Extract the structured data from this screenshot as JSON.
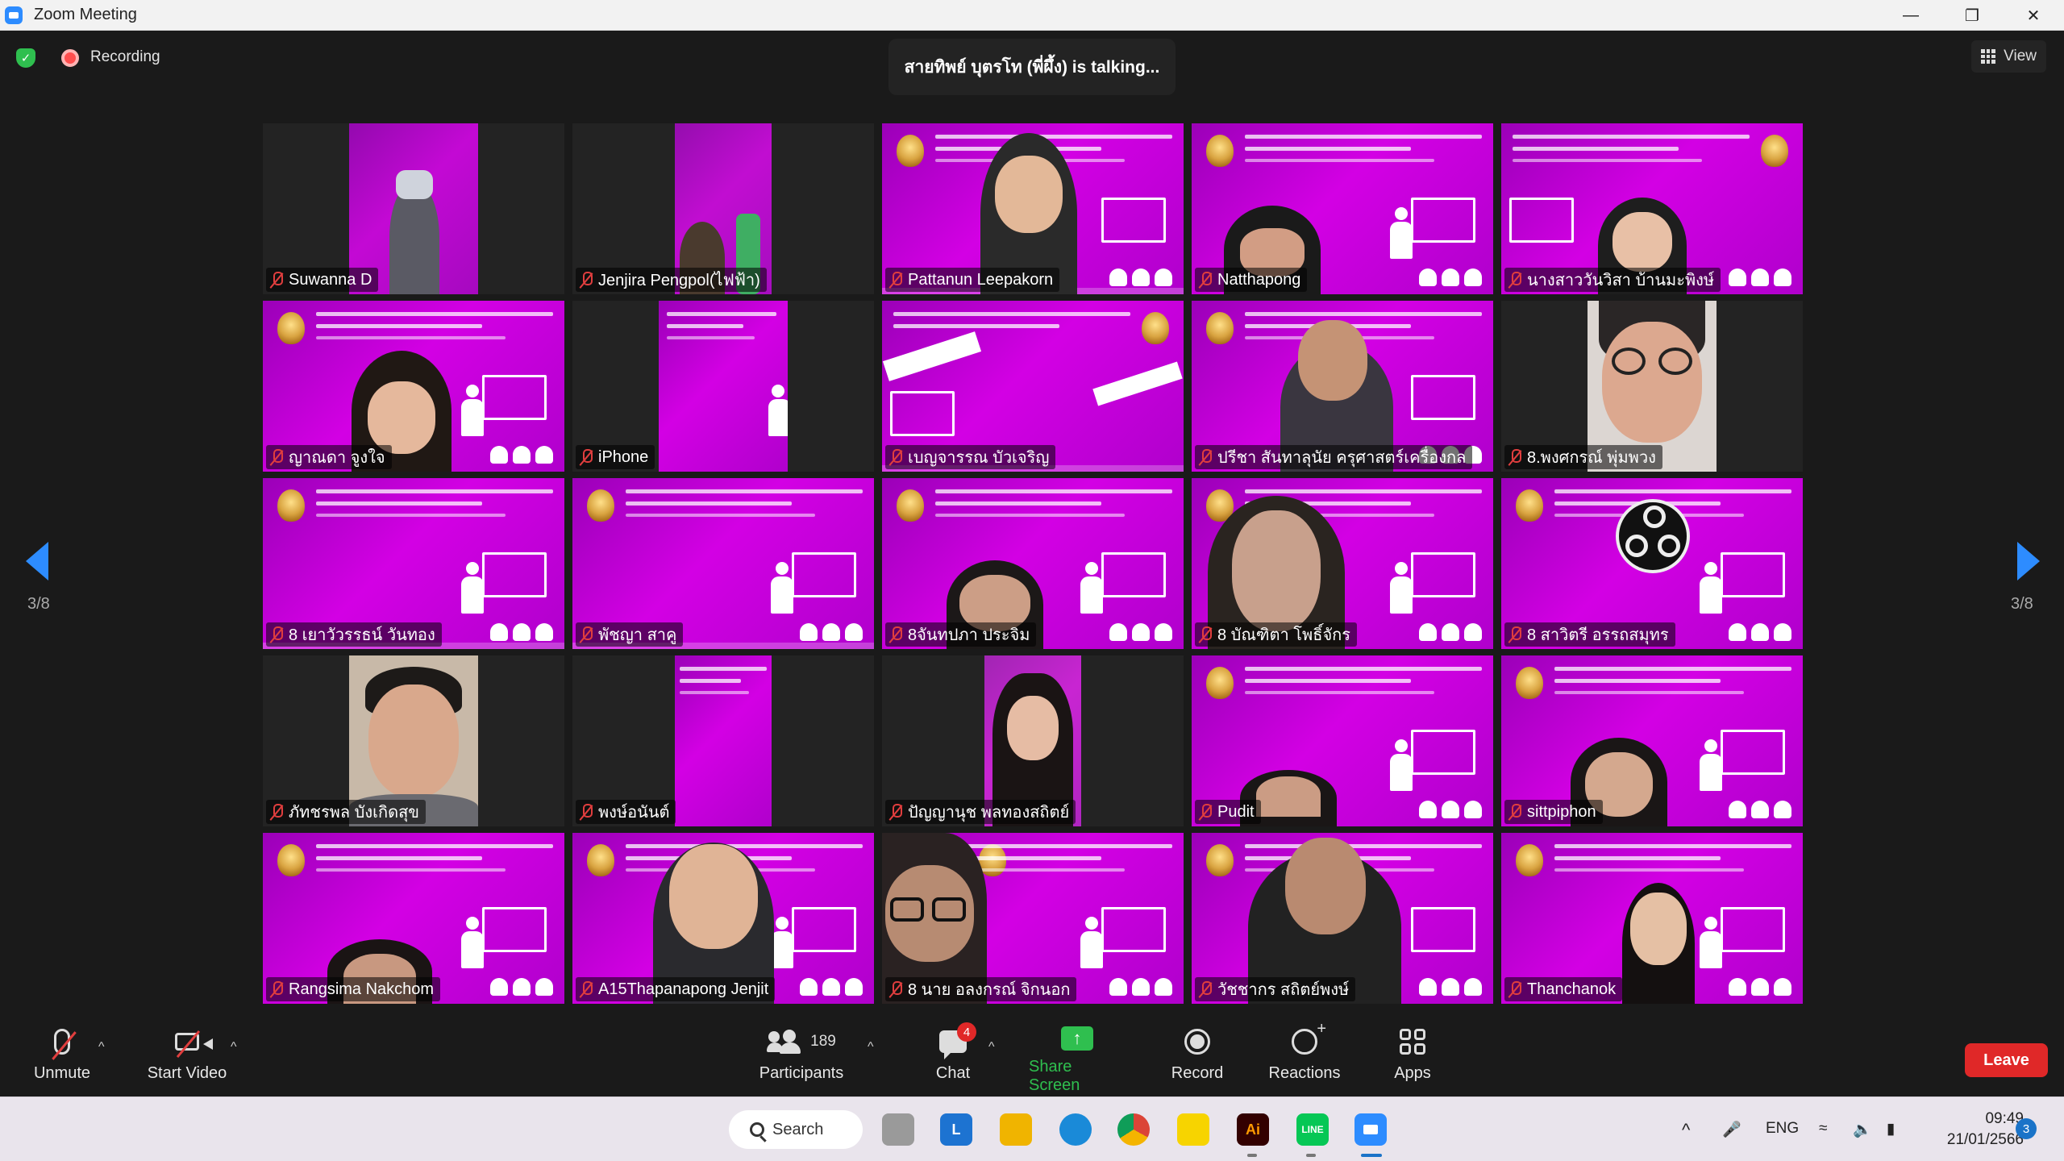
{
  "window": {
    "title": "Zoom Meeting"
  },
  "top_bar": {
    "recording_label": "Recording",
    "talking_text": "สายทิพย์ บุตรโท (พี่ผึ้ง) is talking...",
    "view_label": "View"
  },
  "pagination": {
    "left": "3/8",
    "right": "3/8"
  },
  "participants": [
    {
      "name": "Suwanna D"
    },
    {
      "name": "Jenjira Pengpol(ไฟฟ้า)"
    },
    {
      "name": "Pattanun Leepakorn"
    },
    {
      "name": "Natthapong"
    },
    {
      "name": "นางสาววันวิสา บ้านมะพิงษ์"
    },
    {
      "name": "ญาณดา จูงใจ"
    },
    {
      "name": "iPhone"
    },
    {
      "name": "เบญจารรณ บัวเจริญ"
    },
    {
      "name": "ปรีชา สันทาลุนัย ครุศาสตร์เครื่องกล"
    },
    {
      "name": "8.พงศกรณ์ พุ่มพวง"
    },
    {
      "name": "8 เยาวัวรรธน์ วันทอง"
    },
    {
      "name": "พัชญา สาคู"
    },
    {
      "name": "8จันทปภา ประจิม"
    },
    {
      "name": "8 บัณฑิตา  โพธิ์จักร"
    },
    {
      "name": "8 สาวิตรี อรรถสมุทร"
    },
    {
      "name": "ภัทชรพล บังเกิดสุข"
    },
    {
      "name": "พงษ์อนันต์"
    },
    {
      "name": "ปัญญานุช พลทองสถิตย์"
    },
    {
      "name": "Pudit"
    },
    {
      "name": "sittpiphon"
    },
    {
      "name": "Rangsima Nakchom"
    },
    {
      "name": "A15Thapanapong Jenjit"
    },
    {
      "name": "8 นาย อลงกรณ์ จิกนอก"
    },
    {
      "name": "วัชชากร สถิตย์พงษ์"
    },
    {
      "name": "Thanchanok"
    }
  ],
  "controls": {
    "unmute": "Unmute",
    "start_video": "Start Video",
    "participants_label": "Participants",
    "participants_count": "189",
    "chat_label": "Chat",
    "chat_badge": "4",
    "share_label": "Share Screen",
    "record_label": "Record",
    "reactions_label": "Reactions",
    "apps_label": "Apps",
    "leave_label": "Leave"
  },
  "taskbar": {
    "search_label": "Search",
    "language": "ENG",
    "time": "09:49",
    "date": "21/01/2566",
    "notification_count": "3"
  },
  "colors": {
    "accent": "#2d8cff",
    "leave": "#e02828",
    "share": "#2fbf4f",
    "slide_magenta": "#c800dc"
  }
}
